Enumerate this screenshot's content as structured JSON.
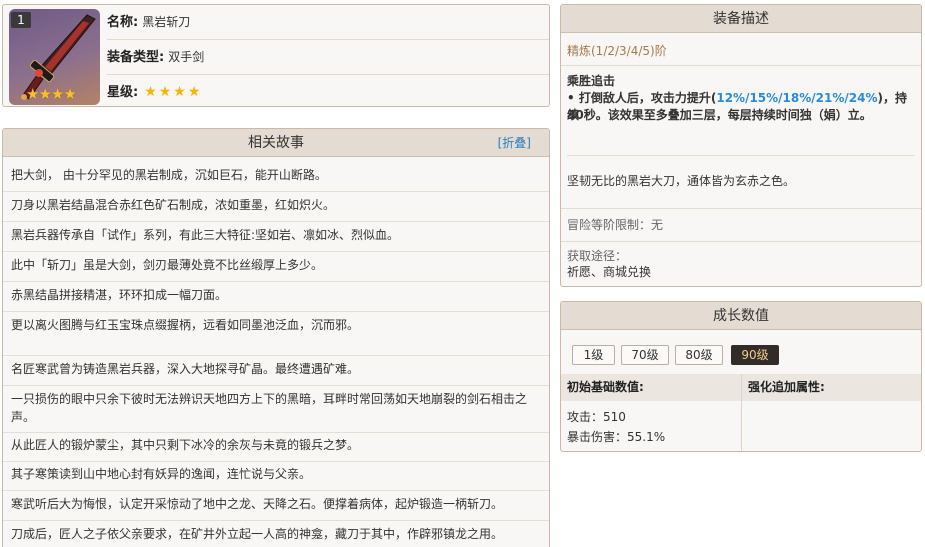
{
  "info": {
    "level_badge": "1",
    "stars_img": "★★★★",
    "name_label": "名称:",
    "name_value": "黑岩斩刀",
    "type_label": "装备类型:",
    "type_value": "双手剑",
    "rarity_label": "星级:",
    "rarity_stars": "★★★★"
  },
  "story": {
    "title": "相关故事",
    "fold_link": "[折叠]",
    "lines": [
      "把大剑， 由十分罕见的黑岩制成，沉如巨石，能开山断路。",
      "刀身以黑岩结晶混合赤红色矿石制成，浓如重墨，红如炽火。",
      "黑岩兵器传承自「试作」系列，有此三大特征:坚如岩、凛如冰、烈似血。",
      "此中「斩刀」虽是大剑，剑刃最薄处竟不比丝缎厚上多少。",
      "赤黑结晶拼接精湛，环环扣成一幅刀面。",
      "更以离火图腾与红玉宝珠点缀握柄，远看如同墨池泛血，沉而邪。",
      "名匠寒武曾为铸造黑岩兵器，深入大地探寻矿晶。最终遭遇矿难。",
      "一只损伤的眼中只余下彼时无法辨识天地四方上下的黑暗，耳畔时常回荡如天地崩裂的剑石相击之",
      "声。",
      "从此匠人的锻炉蒙尘，其中只剩下冰冷的余灰与未竟的锻兵之梦。",
      "其子寒策读到山中地心封有妖异的逸闻，连忙说与父亲。",
      "寒武听后大为悔恨，认定开采惊动了地中之龙、天降之石。便撑着病体，起炉锻造一柄斩刀。",
      "刀成后，匠人之子依父亲要求，在矿井外立起一人高的神龛，藏刀于其中，作辟邪镇龙之用。"
    ]
  },
  "desc": {
    "title": "装备描述",
    "refine": "精炼(1/2/3/4/5)阶",
    "skill_name": "乘胜追击",
    "skill_pre": "• 打倒敌人后，攻击力提升(",
    "skill_values": "12%/15%/18%/21%/24%",
    "skill_post": ")，持续",
    "skill_line2": "30秒。该效果至多叠加三层，每层持续时间独（娟）立。",
    "flavor": "坚韧无比的黑岩大刀，通体皆为玄赤之色。",
    "rank_limit": "冒险等阶限制：无",
    "source_label": "获取途径：",
    "source_value": "祈愿、商城兑换"
  },
  "growth": {
    "title": "成长数值",
    "levels": [
      "1级",
      "70级",
      "80级",
      "90级"
    ],
    "active_level": "90级",
    "base_header": "初始基础数值:",
    "bonus_header": "强化追加属性:",
    "atk": "攻击：510",
    "crit_dmg": "暴击伤害：55.1%"
  },
  "colors": {
    "accent": "#2b8bd6",
    "header_bg": "#e4dcd2",
    "border": "#c9b9a6",
    "active_btn": "#312c27",
    "star": "#f6b500"
  },
  "icons": {
    "weapon": "claymore-icon",
    "star": "star-icon"
  }
}
